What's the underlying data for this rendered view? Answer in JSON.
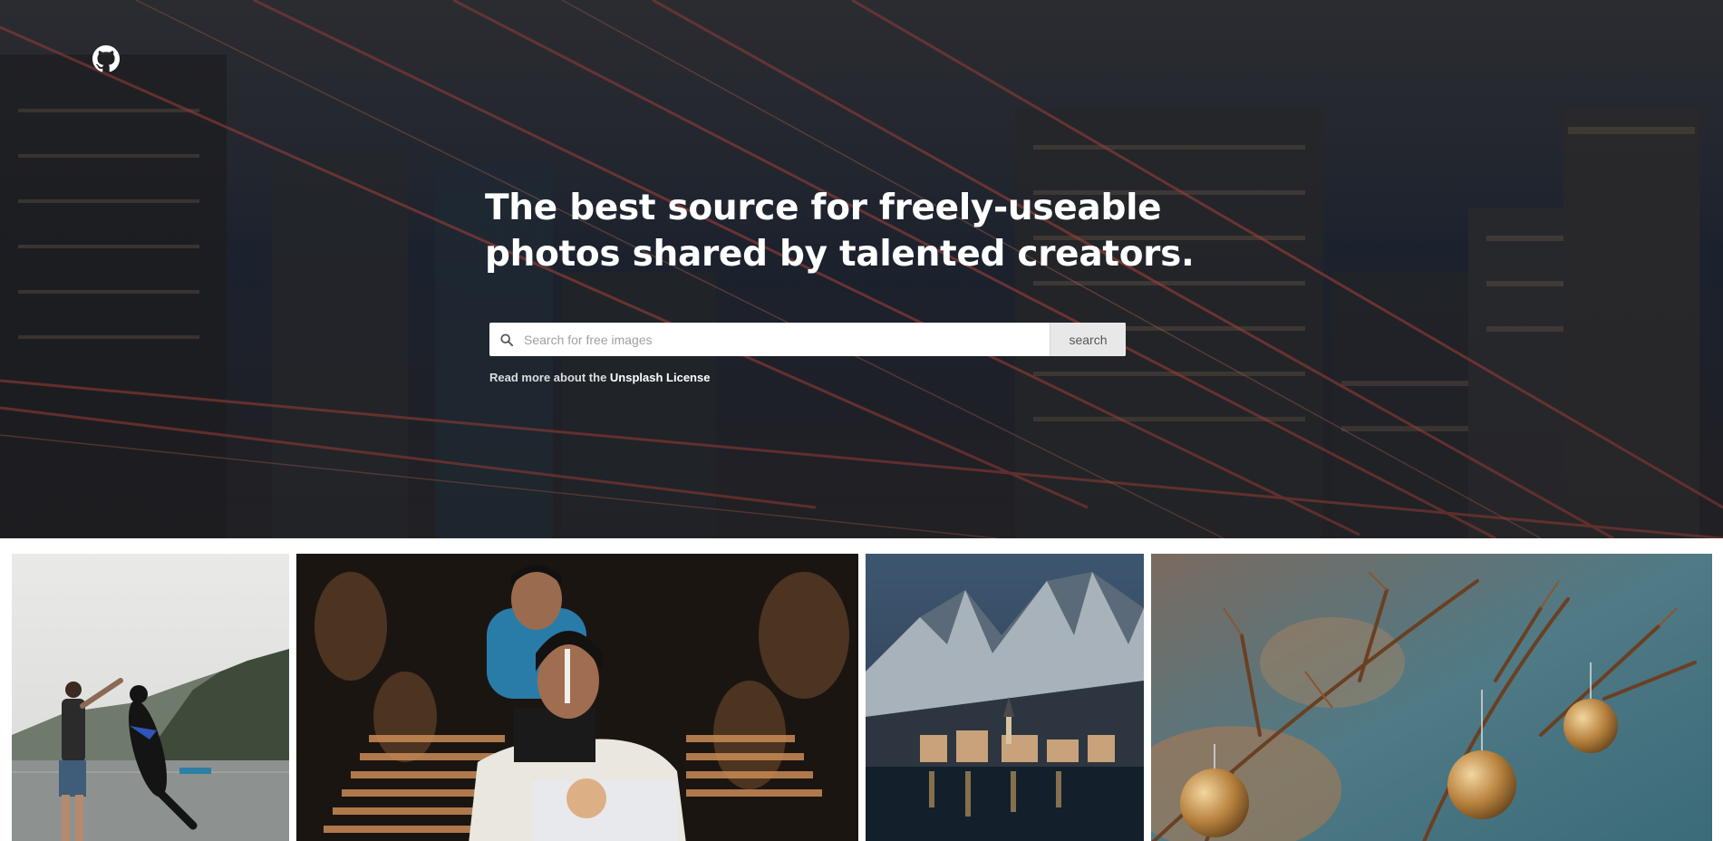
{
  "header": {
    "github_icon": "github-icon"
  },
  "hero": {
    "title_line1": "The best source for freely-useable",
    "title_line2": "photos shared by talented creators.",
    "search": {
      "placeholder": "Search for free images",
      "value": "",
      "button_label": "search",
      "icon": "search-icon"
    },
    "license": {
      "prefix": "Read more about the",
      "link_text": "Unsplash License"
    }
  },
  "gallery": {
    "photos": [
      {
        "subject": "man-with-dog-by-lake"
      },
      {
        "subject": "women-at-night-protest"
      },
      {
        "subject": "snowy-mountain-village"
      },
      {
        "subject": "christmas-ornaments-on-branches"
      }
    ]
  },
  "colors": {
    "hero_dark": "#1f2228",
    "light_streak": "#d84a3a",
    "button_bg": "#e8e8e8",
    "text_white": "#ffffff"
  }
}
